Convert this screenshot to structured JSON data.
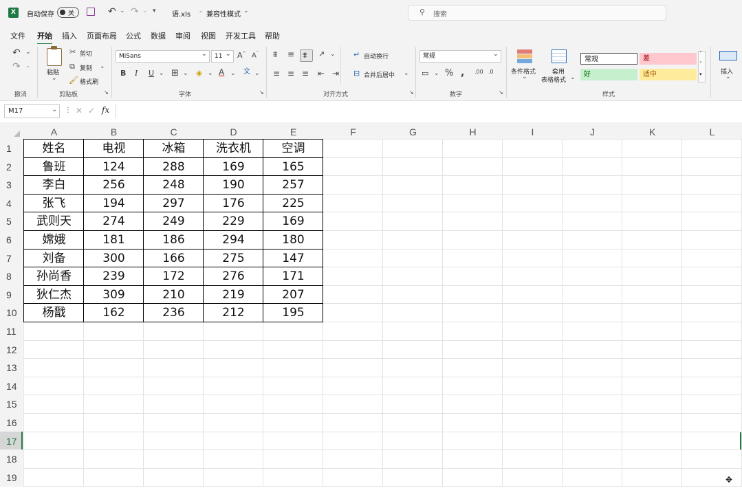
{
  "titlebar": {
    "autosave_label": "自动保存",
    "autosave_state": "关",
    "filename": "语.xls",
    "mode": "兼容性模式",
    "search_placeholder": "搜索"
  },
  "menu": [
    "文件",
    "开始",
    "插入",
    "页面布局",
    "公式",
    "数据",
    "审阅",
    "视图",
    "开发工具",
    "帮助"
  ],
  "ribbon": {
    "undo_group": "撤消",
    "clipboard": {
      "paste": "粘贴",
      "cut": "剪切",
      "copy": "复制",
      "format_painter": "格式刷",
      "label": "剪贴板"
    },
    "font": {
      "name": "MiSans",
      "size": "11",
      "label": "字体"
    },
    "alignment": {
      "wrap": "自动换行",
      "merge": "合并后居中",
      "label": "对齐方式"
    },
    "number": {
      "format": "常规",
      "label": "数字"
    },
    "styles": {
      "conditional": "条件格式",
      "table_line1": "套用",
      "table_line2": "表格格式",
      "normal": "常规",
      "bad": "差",
      "good": "好",
      "neutral": "适中",
      "label": "样式"
    },
    "insert": "插入",
    "colors": {
      "bad_bg": "#ffc7ce",
      "bad_fg": "#9c0006",
      "good_bg": "#c6efce",
      "good_fg": "#006100",
      "neutral_bg": "#ffeb9c",
      "neutral_fg": "#9c5700"
    }
  },
  "formula_bar": {
    "name_box": "M17",
    "fx": "fx",
    "value": ""
  },
  "columns": [
    "A",
    "B",
    "C",
    "D",
    "E",
    "F",
    "G",
    "H",
    "I",
    "J",
    "K",
    "L"
  ],
  "rows": [
    "1",
    "2",
    "3",
    "4",
    "5",
    "6",
    "7",
    "8",
    "9",
    "10",
    "11",
    "12",
    "13",
    "14",
    "15",
    "16",
    "17",
    "18",
    "19"
  ],
  "active_row": "17",
  "table": {
    "headers": [
      "姓名",
      "电视",
      "冰箱",
      "洗衣机",
      "空调"
    ],
    "rows": [
      [
        "鲁班",
        "124",
        "288",
        "169",
        "165"
      ],
      [
        "李白",
        "256",
        "248",
        "190",
        "257"
      ],
      [
        "张飞",
        "194",
        "297",
        "176",
        "225"
      ],
      [
        "武则天",
        "274",
        "249",
        "229",
        "169"
      ],
      [
        "嫦娥",
        "181",
        "186",
        "294",
        "180"
      ],
      [
        "刘备",
        "300",
        "166",
        "275",
        "147"
      ],
      [
        "孙尚香",
        "239",
        "172",
        "276",
        "171"
      ],
      [
        "狄仁杰",
        "309",
        "210",
        "219",
        "207"
      ],
      [
        "杨戬",
        "162",
        "236",
        "212",
        "195"
      ]
    ]
  },
  "accent": "#1e7b45"
}
